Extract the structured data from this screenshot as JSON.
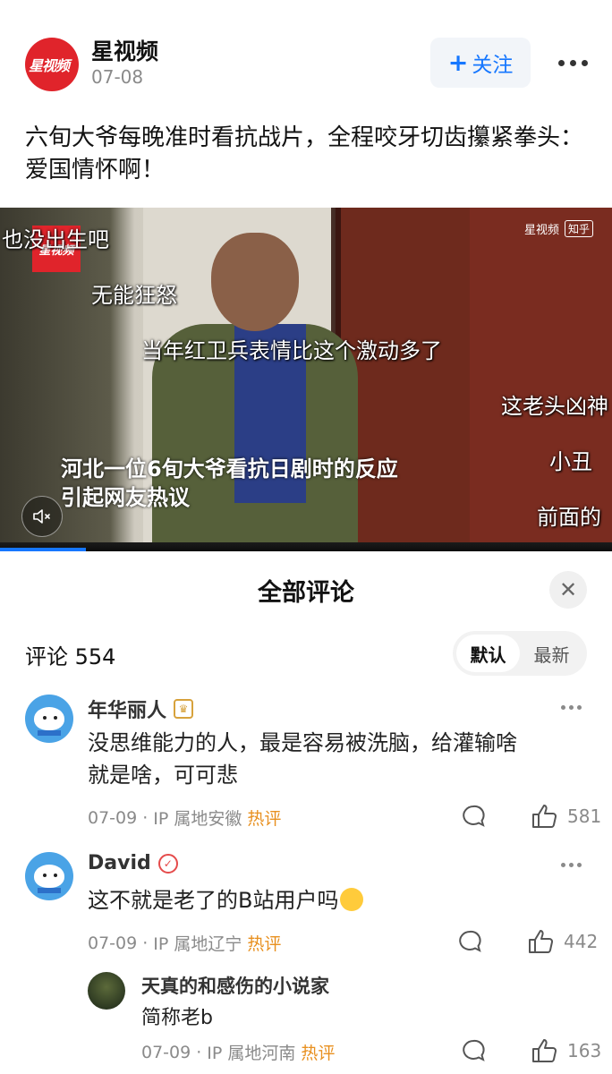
{
  "header": {
    "author_name": "星视频",
    "date": "07-08",
    "follow_label": "关注",
    "follow_plus": "+",
    "logo_text": "星视频"
  },
  "post": {
    "title": "六旬大爷每晚准时看抗战片，全程咬牙切齿攥紧拳头：爱国情怀啊！"
  },
  "video": {
    "danmu": [
      "也没出生吧",
      "无能狂怒",
      "当年红卫兵表情比这个激动多了",
      "这老头凶神",
      "小丑",
      "前面的"
    ],
    "caption_line1": "河北一位6旬大爷看抗日剧时的反应",
    "caption_line2": "引起网友热议",
    "watermark_channel": "星视频",
    "watermark_zhihu": "知乎",
    "corner_logo": "星视频",
    "progress": 0.14
  },
  "comments_panel": {
    "title": "全部评论",
    "count_label": "评论",
    "count": "554",
    "sort_default": "默认",
    "sort_latest": "最新",
    "active_sort": "默认"
  },
  "comments": [
    {
      "name": "年华丽人",
      "badge": "crown",
      "text_line1": "没思维能力的人，最是容易被洗脑，给灌输啥",
      "text_line2": "就是啥，可可悲",
      "date": "07-09",
      "separator": "·",
      "location": "IP 属地安徽",
      "tag": "热评",
      "likes": "581"
    },
    {
      "name": "David",
      "badge": "verified",
      "text_line1": "这不就是老了的B站用户吗",
      "date": "07-09",
      "separator": "·",
      "location": "IP 属地辽宁",
      "tag": "热评",
      "likes": "442"
    },
    {
      "name": "天真的和感伤的小说家",
      "text_line1": "简称老b",
      "date": "07-09",
      "separator": "·",
      "location": "IP 属地河南",
      "tag": "热评",
      "likes": "163"
    }
  ],
  "colors": {
    "accent": "#1677ff",
    "hot_tag": "#e8901f",
    "logo_red": "#e0242b"
  }
}
